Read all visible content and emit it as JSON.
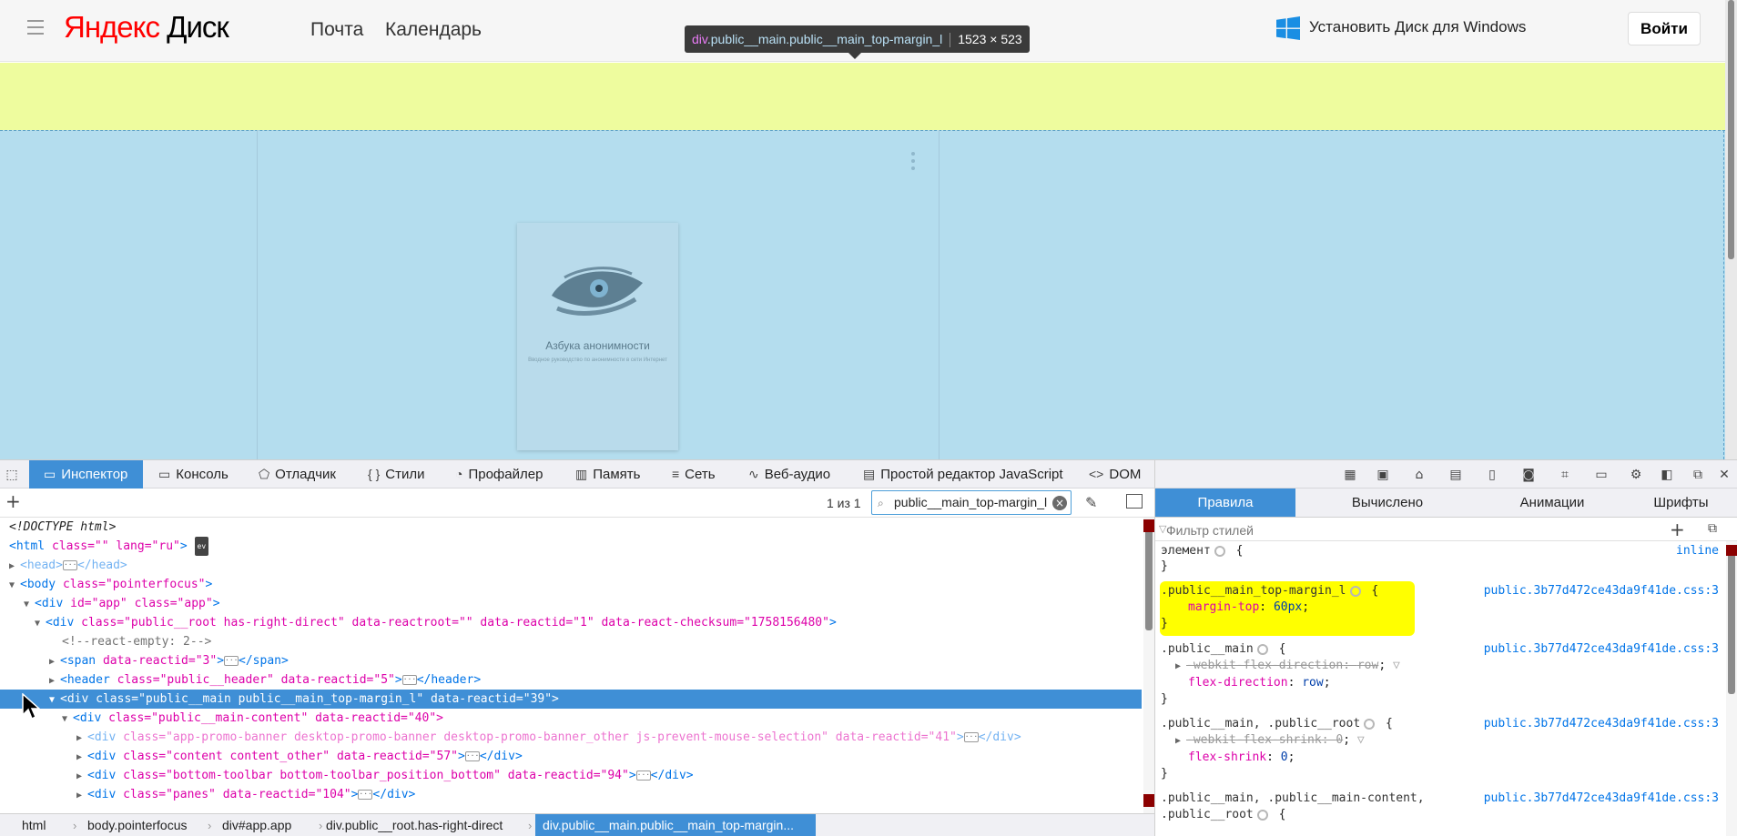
{
  "site_header": {
    "logo_prefix": "Яндекс",
    "logo_suffix": " Диск",
    "nav": [
      "Почта",
      "Календарь"
    ],
    "install_label": "Установить Диск для Windows",
    "login_label": "Войти"
  },
  "highlighter": {
    "tag": "div",
    "classes": ".public__main.public__main_top-margin_l",
    "dimensions": "1523 × 523"
  },
  "book": {
    "title": "Азбука анонимности",
    "subtitle": "Вводное руководство по анонимности в сети Интернет"
  },
  "devtools": {
    "tabs": [
      {
        "label": "Инспектор",
        "icon": "inspector-icon"
      },
      {
        "label": "Консоль",
        "icon": "console-icon"
      },
      {
        "label": "Отладчик",
        "icon": "debugger-icon"
      },
      {
        "label": "Стили",
        "icon": "style-editor-icon"
      },
      {
        "label": "Профайлер",
        "icon": "profiler-icon"
      },
      {
        "label": "Память",
        "icon": "memory-icon"
      },
      {
        "label": "Сеть",
        "icon": "network-icon"
      },
      {
        "label": "Веб-аудио",
        "icon": "web-audio-icon"
      },
      {
        "label": "Простой редактор JavaScript",
        "icon": "scratchpad-icon"
      },
      {
        "label": "DOM",
        "icon": "dom-icon"
      }
    ],
    "search": {
      "match_count": "1 из 1",
      "value": "public__main_top-margin_l"
    },
    "tree": {
      "doctype": "<!DOCTYPE html>",
      "html_open": "<html",
      "html_attrs": " class=\"\" lang=\"ru\"",
      "ev_badge": "ev",
      "head": "<head>",
      "head_close": "</head>",
      "body_tag": "<body",
      "body_attrs": " class=\"pointerfocus\"",
      "app_tag": "<div",
      "app_attrs": " id=\"app\" class=\"app\"",
      "root_tag": "<div",
      "root_attrs": " class=\"public__root has-right-direct\" data-reactroot=\"\" data-reactid=\"1\" data-react-checksum=\"1758156480\"",
      "comment": "<!--react-empty: 2-->",
      "span_tag": "<span",
      "span_attrs": " data-reactid=\"3\"",
      "span_close": "</span>",
      "header_tag": "<header",
      "header_attrs": " class=\"public__header\" data-reactid=\"5\"",
      "header_close": "</header>",
      "main_tag": "<div",
      "main_attrs": " class=\"public__main public__main_top-margin_l\" data-reactid=\"39\">",
      "content_tag": "<div",
      "content_attrs": " class=\"public__main-content\" data-reactid=\"40\">",
      "promo_tag": "<div",
      "promo_attrs": " class=\"app-promo-banner desktop-promo-banner desktop-promo-banner_other js-prevent-mouse-selection\" data-reactid=\"41\"",
      "promo_close": "</div>",
      "content2_tag": "<div",
      "content2_attrs": " class=\"content content_other\" data-reactid=\"57\"",
      "content2_close": "</div>",
      "toolbar_tag": "<div",
      "toolbar_attrs": " class=\"bottom-toolbar bottom-toolbar_position_bottom\" data-reactid=\"94\"",
      "toolbar_close": "</div>",
      "panes_tag": "<div",
      "panes_attrs": " class=\"panes\" data-reactid=\"104\"",
      "panes_close": "</div>"
    },
    "breadcrumbs": [
      "html",
      "body.pointerfocus",
      "div#app.app",
      "div.public__root.has-right-direct",
      "div.public__main.public__main_top-margin..."
    ],
    "rules_tabs": [
      "Правила",
      "Вычислено",
      "Анимации",
      "Шрифты"
    ],
    "filter_placeholder": "Фильтр стилей",
    "rules": {
      "element_selector": "элемент",
      "inline_label": "inline",
      "r1_selector": ".public__main_top-margin_l",
      "r1_prop": "margin-top",
      "r1_val": "60px",
      "r2_selector": ".public__main",
      "r2_prop1": "-webkit-flex-direction",
      "r2_val1": "row",
      "r2_prop2": "flex-direction",
      "r2_val2": "row",
      "r3_selector": ".public__main, .public__root",
      "r3_prop1": "-webkit-flex-shrink",
      "r3_val1": "0",
      "r3_prop2": "flex-shrink",
      "r3_val2": "0",
      "r4_selector_line1": ".public__main, .public__main-content,",
      "r4_selector_line2": ".public__root",
      "source": "public.3b77d472ce43da9f41de.css:3"
    }
  }
}
